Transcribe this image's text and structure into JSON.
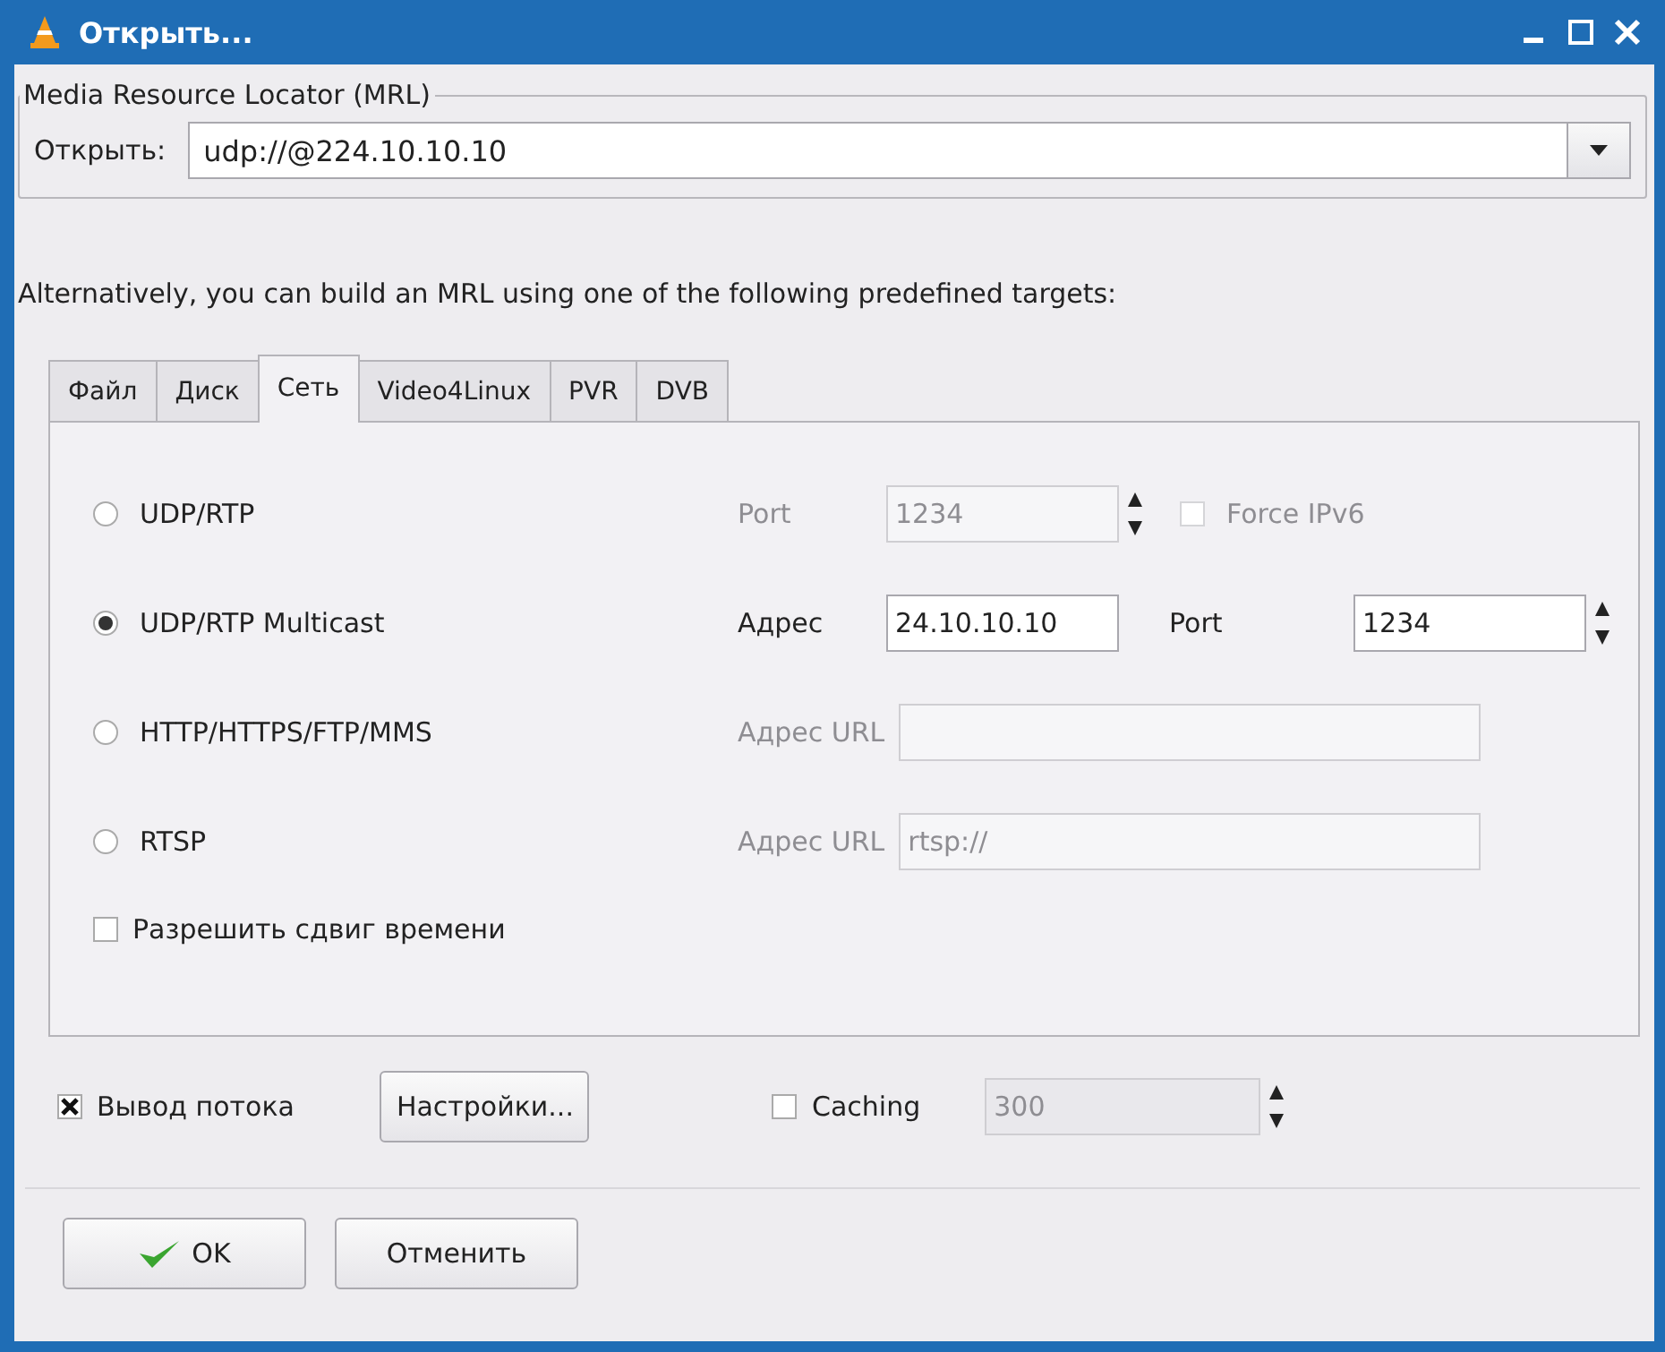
{
  "window": {
    "title": "Открыть..."
  },
  "mrl": {
    "legend": "Media Resource Locator (MRL)",
    "label": "Открыть:",
    "value": "udp://@224.10.10.10"
  },
  "hint": "Alternatively, you can build an MRL using one of the following predefined targets:",
  "tabs": [
    {
      "label": "Файл",
      "selected": false
    },
    {
      "label": "Диск",
      "selected": false
    },
    {
      "label": "Сеть",
      "selected": true
    },
    {
      "label": "Video4Linux",
      "selected": false
    },
    {
      "label": "PVR",
      "selected": false
    },
    {
      "label": "DVB",
      "selected": false
    }
  ],
  "targets": [
    {
      "label": "UDP/RTP",
      "selected": false,
      "fields": [
        {
          "kind": "spin",
          "label": "Port",
          "value": "1234",
          "disabled": true
        },
        {
          "kind": "checkbox",
          "label": "Force IPv6",
          "checked": false,
          "disabled": true
        }
      ]
    },
    {
      "label": "UDP/RTP Multicast",
      "selected": true,
      "fields": [
        {
          "kind": "text",
          "label": "Адрес",
          "value": "24.10.10.10",
          "disabled": false
        },
        {
          "kind": "spin",
          "label": "Port",
          "value": "1234",
          "disabled": false
        }
      ]
    },
    {
      "label": "HTTP/HTTPS/FTP/MMS",
      "selected": false,
      "fields": [
        {
          "kind": "url",
          "label": "Адрес URL",
          "disabled": true
        }
      ]
    },
    {
      "label": "RTSP",
      "selected": false,
      "fields": [
        {
          "kind": "url",
          "label": "Адрес URL",
          "value": "rtsp://",
          "disabled": true
        }
      ]
    }
  ],
  "timeshift": {
    "label": "Разрешить сдвиг времени",
    "checked": false
  },
  "stream_output": {
    "label": "Вывод потока",
    "checked": true
  },
  "settings_button": "Настройки...",
  "caching": {
    "label": "Caching",
    "checked": false,
    "value": "300",
    "disabled": true
  },
  "buttons": [
    {
      "label": "OK",
      "kind": "ok"
    },
    {
      "label": "Отменить",
      "kind": "cancel"
    }
  ]
}
